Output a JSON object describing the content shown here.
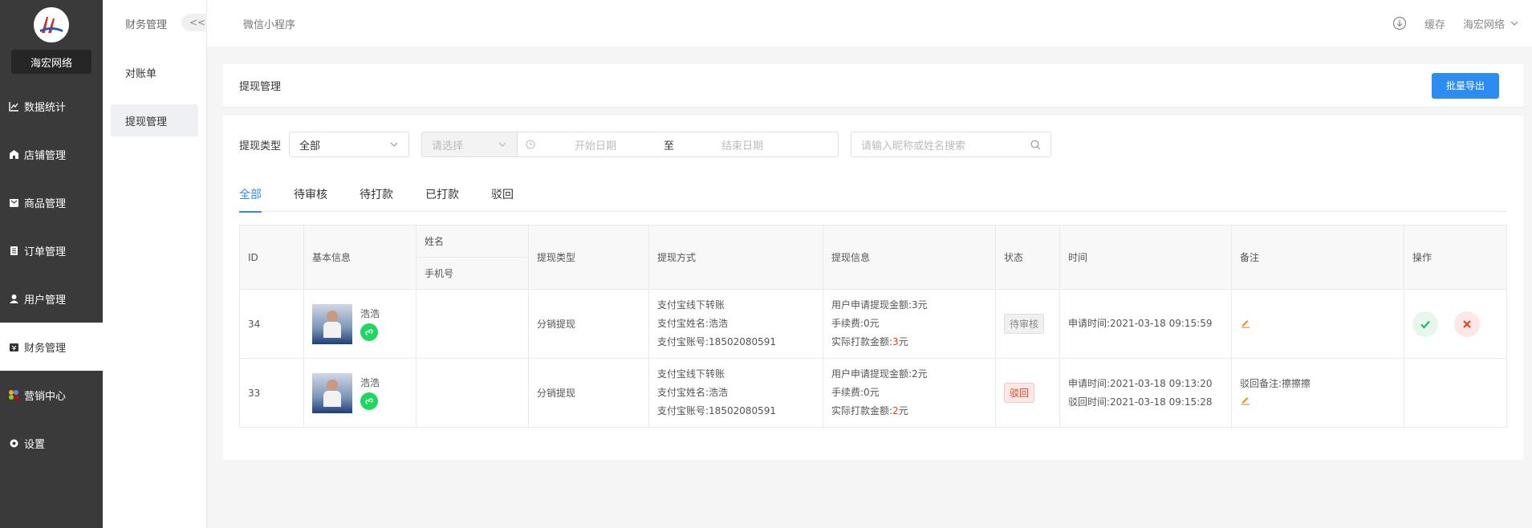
{
  "sidebar": {
    "brand": "海宏网络",
    "items": [
      {
        "label": "数据统计",
        "icon": "chart-icon"
      },
      {
        "label": "店铺管理",
        "icon": "shop-icon"
      },
      {
        "label": "商品管理",
        "icon": "goods-icon"
      },
      {
        "label": "订单管理",
        "icon": "order-icon"
      },
      {
        "label": "用户管理",
        "icon": "user-icon"
      },
      {
        "label": "财务管理",
        "icon": "finance-icon"
      },
      {
        "label": "营销中心",
        "icon": "marketing-icon"
      },
      {
        "label": "设置",
        "icon": "settings-icon"
      }
    ]
  },
  "subside": {
    "title": "财务管理",
    "collapse": "<<",
    "items": [
      "对账单",
      "提现管理"
    ]
  },
  "topbar": {
    "crumb": "微信小程序",
    "cache": "缓存",
    "account": "海宏网络"
  },
  "page": {
    "title": "提现管理",
    "export_btn": "批量导出"
  },
  "filters": {
    "type_label": "提现类型",
    "type_value": "全部",
    "select_placeholder": "请选择",
    "start_placeholder": "开始日期",
    "range_sep": "至",
    "end_placeholder": "结束日期",
    "search_placeholder": "请输入昵称或姓名搜索"
  },
  "tabs": [
    "全部",
    "待审核",
    "待打款",
    "已打款",
    "驳回"
  ],
  "table": {
    "headers": {
      "id": "ID",
      "basic": "基本信息",
      "name": "姓名",
      "phone": "手机号",
      "type": "提现类型",
      "method": "提现方式",
      "info": "提现信息",
      "status": "状态",
      "time": "时间",
      "remark": "备注",
      "action": "操作"
    },
    "rows": [
      {
        "id": "34",
        "nickname": "浩浩",
        "type": "分销提现",
        "method": [
          "支付宝线下转账",
          "支付宝姓名:浩浩",
          "支付宝账号:18502080591"
        ],
        "info_apply": "用户申请提现金额:3元",
        "info_fee": "手续费:0元",
        "info_actual_prefix": "实际打款金额:",
        "info_actual_amount": "3",
        "info_actual_suffix": "元",
        "status": "待审核",
        "time1": "申请时间:2021-03-18 09:15:59",
        "time2": "",
        "remark": ""
      },
      {
        "id": "33",
        "nickname": "浩浩",
        "type": "分销提现",
        "method": [
          "支付宝线下转账",
          "支付宝姓名:浩浩",
          "支付宝账号:18502080591"
        ],
        "info_apply": "用户申请提现金额:2元",
        "info_fee": "手续费:0元",
        "info_actual_prefix": "实际打款金额:",
        "info_actual_amount": "2",
        "info_actual_suffix": "元",
        "status": "驳回",
        "time1": "申请时间:2021-03-18 09:13:20",
        "time2": "驳回时间:2021-03-18 09:15:28",
        "remark": "驳回备注:擦擦擦"
      }
    ]
  }
}
